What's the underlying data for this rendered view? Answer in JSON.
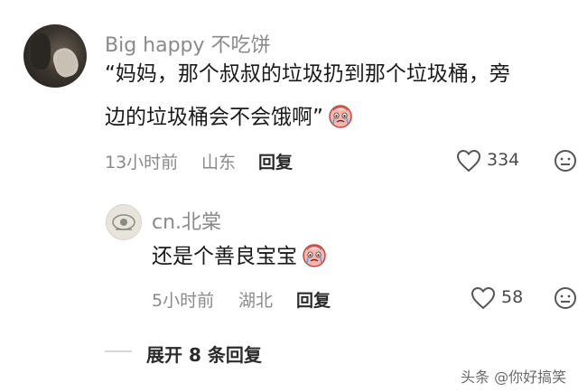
{
  "comment": {
    "username": "Big happy 不吃饼",
    "text_line1": "“妈妈，那个叔叔的垃圾扔到那个垃圾桶，旁",
    "text_line2": "边的垃圾桶会不会饿啊”",
    "emoji": "crying-face-emoji",
    "time": "13小时前",
    "location": "山东",
    "reply_label": "回复",
    "like_count": "334"
  },
  "reply": {
    "username": "cn.北棠",
    "text": "还是个善良宝宝",
    "emoji": "crying-face-emoji",
    "time": "5小时前",
    "location": "湖北",
    "reply_label": "回复",
    "like_count": "58"
  },
  "expand": {
    "label": "展开 8 条回复"
  },
  "watermark": "头条 @你好搞笑"
}
